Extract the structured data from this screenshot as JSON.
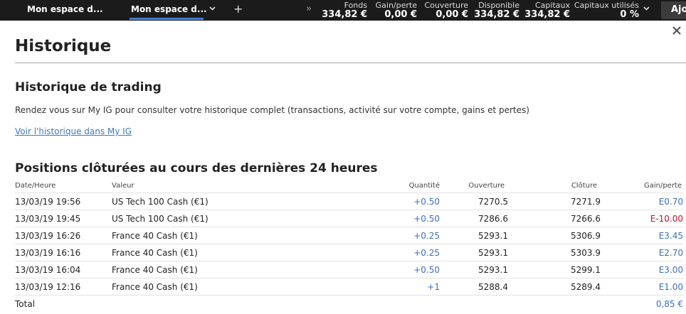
{
  "topbar": {
    "tab1": "Mon espace d...",
    "tab2": "Mon espace d...",
    "add": "+",
    "more": "»",
    "stats": {
      "fonds": {
        "label": "Fonds",
        "value": "334,82 €"
      },
      "gain": {
        "label": "Gain/perte",
        "value": "0,00 €"
      },
      "couverture": {
        "label": "Couverture",
        "value": "0,00 €"
      },
      "disponible": {
        "label": "Disponible",
        "value": "334,82 €"
      },
      "capitaux": {
        "label": "Capitaux",
        "value": "334,82 €"
      },
      "capitaux_utilises": {
        "label": "Capitaux utilisés",
        "value": "0 %"
      }
    },
    "action_button": "Ajo"
  },
  "page": {
    "title": "Historique",
    "history_title": "Historique de trading",
    "history_desc": "Rendez vous sur My IG pour consulter votre historique complet (transactions, activité sur votre compte, gains et pertes)",
    "history_link": "Voir l'historique dans My IG",
    "closed_title": "Positions clôturées au cours des dernières 24 heures"
  },
  "table": {
    "headers": {
      "date": "Date/Heure",
      "valeur": "Valeur",
      "quantite": "Quantité",
      "ouverture": "Ouverture",
      "cloture": "Clôture",
      "gain": "Gain/perte"
    },
    "rows": [
      {
        "date": "13/03/19 19:56",
        "valeur": "US Tech 100 Cash (€1)",
        "quantite": "+0.50",
        "ouverture": "7270.5",
        "cloture": "7271.9",
        "gain": "E0.70"
      },
      {
        "date": "13/03/19 19:45",
        "valeur": "US Tech 100 Cash (€1)",
        "quantite": "+0.50",
        "ouverture": "7286.6",
        "cloture": "7266.6",
        "gain": "E-10.00"
      },
      {
        "date": "13/03/19 16:26",
        "valeur": "France 40 Cash (€1)",
        "quantite": "+0.25",
        "ouverture": "5293.1",
        "cloture": "5306.9",
        "gain": "E3.45"
      },
      {
        "date": "13/03/19 16:16",
        "valeur": "France 40 Cash (€1)",
        "quantite": "+0.25",
        "ouverture": "5293.1",
        "cloture": "5303.9",
        "gain": "E2.70"
      },
      {
        "date": "13/03/19 16:04",
        "valeur": "France 40 Cash (€1)",
        "quantite": "+0.50",
        "ouverture": "5293.1",
        "cloture": "5299.1",
        "gain": "E3.00"
      },
      {
        "date": "13/03/19 12:16",
        "valeur": "France 40 Cash (€1)",
        "quantite": "+1",
        "ouverture": "5288.4",
        "cloture": "5289.4",
        "gain": "E1.00"
      }
    ],
    "total": {
      "label": "Total",
      "value": "0,85 €"
    }
  },
  "colors": {
    "positive": "#3e6fb8",
    "negative": "#c8102e",
    "accent": "#3f7fd4",
    "topbar": "#1b1b1b"
  }
}
